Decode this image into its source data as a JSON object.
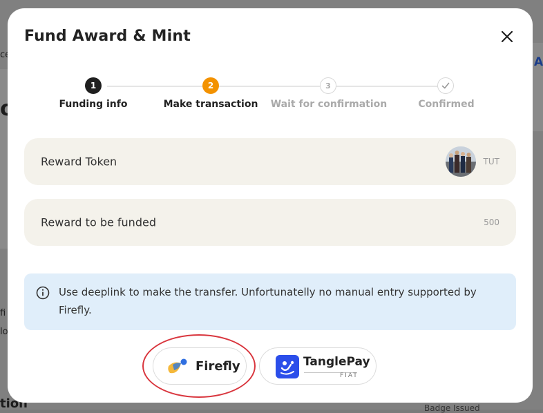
{
  "background": {
    "fragments": [
      "ce",
      "A",
      "o",
      "fi",
      "lo",
      "tion",
      "Badge Issued"
    ]
  },
  "modal": {
    "title": "Fund Award & Mint",
    "close_icon": "close-icon"
  },
  "steps": [
    {
      "number": "1",
      "label": "Funding info",
      "state": "done"
    },
    {
      "number": "2",
      "label": "Make transaction",
      "state": "active"
    },
    {
      "number": "3",
      "label": "Wait for confirmation",
      "state": "pending"
    },
    {
      "number": "",
      "label": "Confirmed",
      "state": "pending"
    }
  ],
  "fields": {
    "reward_token": {
      "label": "Reward Token",
      "value": "TUT"
    },
    "reward_funded": {
      "label": "Reward to be funded",
      "value": "500"
    }
  },
  "info": {
    "text": "Use deeplink to make the transfer. Unfortunatelly no manual entry supported by Firefly."
  },
  "wallets": {
    "firefly": {
      "label": "Firefly"
    },
    "tanglepay": {
      "label": "TanglePay",
      "sub": "FIAT"
    }
  },
  "colors": {
    "step_done": "#1f1f1f",
    "step_active": "#f39200",
    "info_bg": "#e0eefa",
    "field_bg": "#f4f2eb",
    "highlight_ring": "#d9363e"
  }
}
